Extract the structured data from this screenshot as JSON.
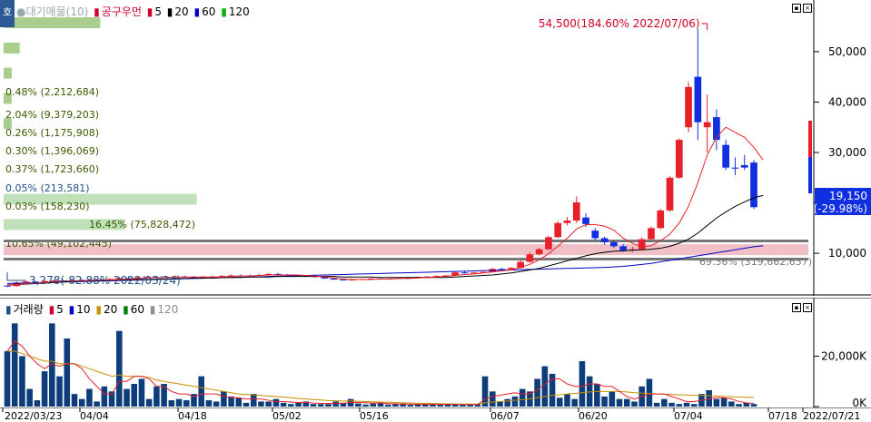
{
  "price_legend": {
    "title": "●대기매물(10)",
    "items": [
      {
        "label": "공구우먼",
        "color": "#d0002a"
      },
      {
        "label": "5",
        "color": "#d0002a"
      },
      {
        "label": "20",
        "color": "#000000"
      },
      {
        "label": "60",
        "color": "#0000c8"
      },
      {
        "label": "120",
        "color": "#00b000"
      }
    ]
  },
  "volume_legend": {
    "title": "거래량",
    "items": [
      {
        "label": "5",
        "color": "#d0002a"
      },
      {
        "label": "10",
        "color": "#0000c8"
      },
      {
        "label": "20",
        "color": "#c89000"
      },
      {
        "label": "60",
        "color": "#008000"
      },
      {
        "label": "120",
        "color": "#909090"
      }
    ]
  },
  "home_tab": "호",
  "annotations": {
    "high": "54,500(184.60% 2022/07/06)",
    "low": "3,278(-82.88% 2022/03/24)",
    "current_price": "19,150",
    "current_change": "(-29.98%)"
  },
  "volume_profile": [
    {
      "label": "0.48% (2,212,684)",
      "price": 55000,
      "width": 0.12,
      "color": "#a0c880"
    },
    {
      "label": "2.04% (9,379,203)",
      "price": 50000,
      "width": 0.02,
      "color": "#a0c880"
    },
    {
      "label": "0.26% (1,175,908)",
      "price": 45000,
      "width": 0.01,
      "color": "#a0c880"
    },
    {
      "label": "0.30% (1,396,069)",
      "price": 40000,
      "width": 0.01,
      "color": "#a0c880"
    },
    {
      "label": "0.37% (1,723,660)",
      "price": 35000,
      "width": 0.01,
      "color": "#a0c880"
    },
    {
      "label": "0.05% (213,581)",
      "price": 30000,
      "width": 0.0,
      "color": "#a0c880"
    },
    {
      "label": "0.03% (158,230)",
      "price": 25000,
      "width": 0.0,
      "color": "#a0c880"
    },
    {
      "label": "16.45% (75,828,472)",
      "price": 20000,
      "width": 0.24,
      "color": "#b8ddb0"
    },
    {
      "label": "10.65% (49,102,445)",
      "price": 15000,
      "width": 0.15,
      "color": "#b8ddb0"
    },
    {
      "label": "69.36% (319,662,657)",
      "price": 10000,
      "width": 1.0,
      "color": "#f0b8c0"
    }
  ],
  "chart_data": [
    {
      "type": "candlestick",
      "name": "price",
      "y_ticks": [
        "50,000",
        "40,000",
        "30,000",
        "20,000",
        "10,000"
      ],
      "y_tick_values": [
        50000,
        40000,
        30000,
        20000,
        10000
      ],
      "ylim": [
        3000,
        57000
      ],
      "grid": false,
      "candles": [
        {
          "o": 3600,
          "c": 3500,
          "h": 3700,
          "l": 3278
        },
        {
          "o": 3500,
          "c": 4200,
          "h": 4400,
          "l": 3400
        },
        {
          "o": 4200,
          "c": 4400,
          "h": 4600,
          "l": 4000
        },
        {
          "o": 4400,
          "c": 4300,
          "h": 4500,
          "l": 4100
        },
        {
          "o": 4300,
          "c": 4500,
          "h": 4700,
          "l": 4200
        },
        {
          "o": 4500,
          "c": 4600,
          "h": 4800,
          "l": 4300
        },
        {
          "o": 4600,
          "c": 4500,
          "h": 4800,
          "l": 4400
        },
        {
          "o": 4500,
          "c": 4700,
          "h": 4900,
          "l": 4400
        },
        {
          "o": 4700,
          "c": 4600,
          "h": 4900,
          "l": 4500
        },
        {
          "o": 4600,
          "c": 4800,
          "h": 5000,
          "l": 4500
        },
        {
          "o": 4800,
          "c": 4700,
          "h": 5000,
          "l": 4600
        },
        {
          "o": 4700,
          "c": 4900,
          "h": 5100,
          "l": 4600
        },
        {
          "o": 4900,
          "c": 5100,
          "h": 5300,
          "l": 4800
        },
        {
          "o": 5100,
          "c": 5000,
          "h": 5300,
          "l": 4900
        },
        {
          "o": 5000,
          "c": 5200,
          "h": 5400,
          "l": 4900
        },
        {
          "o": 5200,
          "c": 5300,
          "h": 5500,
          "l": 5100
        },
        {
          "o": 5300,
          "c": 5200,
          "h": 5500,
          "l": 5100
        },
        {
          "o": 5200,
          "c": 5300,
          "h": 5500,
          "l": 5100
        },
        {
          "o": 5300,
          "c": 5400,
          "h": 5600,
          "l": 5200
        },
        {
          "o": 5400,
          "c": 5300,
          "h": 5600,
          "l": 5200
        },
        {
          "o": 5300,
          "c": 5200,
          "h": 5500,
          "l": 5100
        },
        {
          "o": 5200,
          "c": 5300,
          "h": 5500,
          "l": 5100
        },
        {
          "o": 5300,
          "c": 5400,
          "h": 5600,
          "l": 5200
        },
        {
          "o": 5400,
          "c": 5500,
          "h": 5700,
          "l": 5300
        },
        {
          "o": 5500,
          "c": 5600,
          "h": 5800,
          "l": 5400
        },
        {
          "o": 5600,
          "c": 5500,
          "h": 5800,
          "l": 5400
        },
        {
          "o": 5500,
          "c": 5600,
          "h": 5800,
          "l": 5400
        },
        {
          "o": 5600,
          "c": 5700,
          "h": 5900,
          "l": 5500
        },
        {
          "o": 5700,
          "c": 5900,
          "h": 6100,
          "l": 5600
        },
        {
          "o": 5900,
          "c": 5800,
          "h": 6100,
          "l": 5700
        },
        {
          "o": 5800,
          "c": 5700,
          "h": 5900,
          "l": 5600
        },
        {
          "o": 5700,
          "c": 5600,
          "h": 5800,
          "l": 5500
        },
        {
          "o": 5600,
          "c": 5500,
          "h": 5700,
          "l": 5400
        },
        {
          "o": 5500,
          "c": 5300,
          "h": 5600,
          "l": 5200
        },
        {
          "o": 5300,
          "c": 5000,
          "h": 5400,
          "l": 4900
        },
        {
          "o": 5000,
          "c": 4800,
          "h": 5100,
          "l": 4700
        },
        {
          "o": 4800,
          "c": 4700,
          "h": 4900,
          "l": 4600
        },
        {
          "o": 4700,
          "c": 4800,
          "h": 4900,
          "l": 4600
        },
        {
          "o": 4800,
          "c": 4900,
          "h": 5000,
          "l": 4700
        },
        {
          "o": 4900,
          "c": 5000,
          "h": 5100,
          "l": 4800
        },
        {
          "o": 5000,
          "c": 4900,
          "h": 5100,
          "l": 4800
        },
        {
          "o": 4900,
          "c": 5000,
          "h": 5100,
          "l": 4800
        },
        {
          "o": 5000,
          "c": 5100,
          "h": 5200,
          "l": 4900
        },
        {
          "o": 5100,
          "c": 5200,
          "h": 5300,
          "l": 5000
        },
        {
          "o": 5200,
          "c": 5300,
          "h": 5400,
          "l": 5100
        },
        {
          "o": 5300,
          "c": 5400,
          "h": 5500,
          "l": 5200
        },
        {
          "o": 5400,
          "c": 5500,
          "h": 5600,
          "l": 5300
        },
        {
          "o": 5500,
          "c": 5600,
          "h": 5700,
          "l": 5400
        },
        {
          "o": 5600,
          "c": 6200,
          "h": 6400,
          "l": 5500
        },
        {
          "o": 6200,
          "c": 6100,
          "h": 6400,
          "l": 6000
        },
        {
          "o": 6100,
          "c": 6200,
          "h": 6300,
          "l": 6000
        },
        {
          "o": 6200,
          "c": 6300,
          "h": 6400,
          "l": 6100
        },
        {
          "o": 6300,
          "c": 6900,
          "h": 7100,
          "l": 6200
        },
        {
          "o": 6900,
          "c": 6800,
          "h": 7100,
          "l": 6700
        },
        {
          "o": 6800,
          "c": 7100,
          "h": 7300,
          "l": 6700
        },
        {
          "o": 7100,
          "c": 8300,
          "h": 8600,
          "l": 7000
        },
        {
          "o": 8300,
          "c": 9800,
          "h": 10200,
          "l": 8100
        },
        {
          "o": 9800,
          "c": 10800,
          "h": 11100,
          "l": 9600
        },
        {
          "o": 10800,
          "c": 13200,
          "h": 13500,
          "l": 10600
        },
        {
          "o": 13200,
          "c": 16000,
          "h": 16400,
          "l": 13000
        },
        {
          "o": 16000,
          "c": 16500,
          "h": 17200,
          "l": 15500
        },
        {
          "o": 16500,
          "c": 20100,
          "h": 21300,
          "l": 16000
        },
        {
          "o": 17100,
          "c": 15800,
          "h": 18000,
          "l": 15200
        },
        {
          "o": 14500,
          "c": 13000,
          "h": 15000,
          "l": 12500
        },
        {
          "o": 13000,
          "c": 12200,
          "h": 13300,
          "l": 11700
        },
        {
          "o": 12200,
          "c": 11400,
          "h": 12500,
          "l": 11000
        },
        {
          "o": 11400,
          "c": 10600,
          "h": 11800,
          "l": 10300
        },
        {
          "o": 10600,
          "c": 10800,
          "h": 11300,
          "l": 10300
        },
        {
          "o": 10800,
          "c": 12800,
          "h": 13200,
          "l": 10600
        },
        {
          "o": 12800,
          "c": 15000,
          "h": 15300,
          "l": 12500
        },
        {
          "o": 15000,
          "c": 18500,
          "h": 18800,
          "l": 14800
        },
        {
          "o": 18500,
          "c": 25000,
          "h": 25300,
          "l": 18300
        },
        {
          "o": 25000,
          "c": 32500,
          "h": 32800,
          "l": 24800
        },
        {
          "o": 35000,
          "c": 43000,
          "h": 44000,
          "l": 34000
        },
        {
          "o": 45000,
          "c": 36000,
          "h": 54500,
          "l": 32500
        },
        {
          "o": 35000,
          "c": 36000,
          "h": 41500,
          "l": 30000
        },
        {
          "o": 37000,
          "c": 32500,
          "h": 38500,
          "l": 30500
        },
        {
          "o": 31500,
          "c": 27000,
          "h": 32500,
          "l": 26500
        },
        {
          "o": 27000,
          "c": 26800,
          "h": 29000,
          "l": 25500
        },
        {
          "o": 27500,
          "c": 27000,
          "h": 29500,
          "l": 26500
        },
        {
          "o": 28000,
          "c": 19150,
          "h": 28500,
          "l": 18800
        }
      ],
      "ma5": [
        3600,
        3800,
        4000,
        4100,
        4200,
        4400,
        4500,
        4500,
        4600,
        4600,
        4700,
        4700,
        4800,
        4900,
        5000,
        5100,
        5200,
        5200,
        5300,
        5300,
        5300,
        5300,
        5300,
        5300,
        5400,
        5500,
        5500,
        5600,
        5700,
        5700,
        5700,
        5700,
        5600,
        5500,
        5300,
        5100,
        4900,
        4800,
        4800,
        4800,
        4900,
        4900,
        5000,
        5000,
        5100,
        5200,
        5300,
        5400,
        5600,
        5800,
        5900,
        6100,
        6300,
        6500,
        6700,
        7200,
        7800,
        8700,
        9900,
        11400,
        13000,
        14800,
        15700,
        15700,
        15400,
        14600,
        13000,
        12000,
        11300,
        11500,
        12500,
        13800,
        16000,
        19300,
        24000,
        29500,
        33000,
        35000,
        34000,
        33000,
        31000,
        28500
      ],
      "ma20": [
        3700,
        3800,
        3900,
        4000,
        4100,
        4200,
        4300,
        4400,
        4500,
        4500,
        4600,
        4600,
        4700,
        4700,
        4800,
        4800,
        4900,
        4900,
        5000,
        5000,
        5100,
        5100,
        5100,
        5200,
        5200,
        5200,
        5300,
        5300,
        5300,
        5400,
        5400,
        5400,
        5400,
        5400,
        5400,
        5400,
        5300,
        5300,
        5300,
        5300,
        5200,
        5200,
        5200,
        5200,
        5200,
        5200,
        5200,
        5200,
        5300,
        5400,
        5500,
        5600,
        5700,
        5900,
        6100,
        6400,
        6700,
        7000,
        7500,
        8000,
        8500,
        9000,
        9500,
        9900,
        10200,
        10400,
        10500,
        10600,
        10700,
        10800,
        11000,
        11400,
        12000,
        12800,
        14000,
        15500,
        17000,
        18200,
        19300,
        20200,
        21000,
        21500
      ],
      "ma60": [
        4000,
        4050,
        4100,
        4150,
        4200,
        4250,
        4300,
        4350,
        4400,
        4450,
        4500,
        4550,
        4600,
        4650,
        4700,
        4750,
        4800,
        4850,
        4900,
        4950,
        5000,
        5050,
        5100,
        5150,
        5200,
        5250,
        5300,
        5350,
        5400,
        5450,
        5500,
        5550,
        5600,
        5650,
        5700,
        5750,
        5800,
        5850,
        5900,
        5950,
        6000,
        6050,
        6100,
        6150,
        6200,
        6250,
        6300,
        6350,
        6400,
        6450,
        6500,
        6550,
        6600,
        6650,
        6700,
        6750,
        6800,
        6850,
        6900,
        6950,
        7000,
        7050,
        7100,
        7150,
        7200,
        7300,
        7400,
        7600,
        7800,
        8000,
        8300,
        8600,
        8900,
        9200,
        9500,
        9800,
        10100,
        10400,
        10700,
        11000,
        11300,
        11500
      ]
    },
    {
      "type": "bar",
      "name": "volume",
      "y_ticks": [
        "20,000K",
        "0K"
      ],
      "y_tick_values": [
        20000,
        0
      ],
      "ylim": [
        0,
        36000
      ],
      "x_ticks": [
        "2022/03/23",
        "04/04",
        "04/18",
        "05/02",
        "05/16",
        "06/07",
        "06/20",
        "07/04",
        "07/18",
        "2022/07/21"
      ],
      "x_tick_index": [
        0,
        13,
        26,
        38,
        50,
        69,
        82,
        95,
        109,
        113
      ],
      "values": [
        22000,
        33000,
        20000,
        7000,
        2500,
        14000,
        33000,
        12000,
        27000,
        5000,
        3000,
        7000,
        2000,
        8000,
        6000,
        30000,
        7000,
        9000,
        11000,
        3000,
        8000,
        9000,
        2500,
        3000,
        2500,
        5000,
        12000,
        2500,
        2000,
        6000,
        4000,
        3500,
        1500,
        5000,
        2000,
        2000,
        3000,
        1500,
        1000,
        1500,
        2000,
        1000,
        1000,
        1000,
        2000,
        1500,
        3000,
        1200,
        800,
        1200,
        1500,
        800,
        1000,
        1200,
        700,
        900,
        1000,
        900,
        700,
        800,
        900,
        700,
        800,
        900,
        12000,
        6000,
        2000,
        3000,
        4000,
        7000,
        6000,
        11000,
        16000,
        13000,
        3500,
        5000,
        3000,
        18000,
        12000,
        9000,
        4000,
        6000,
        3000,
        3000,
        2000,
        8000,
        11000,
        1500,
        3000,
        1500,
        1000,
        1500,
        1000,
        5000,
        6500,
        3000,
        3500,
        2000,
        1000,
        1500,
        1000
      ],
      "colors_up": [
        0,
        5,
        8,
        15,
        18,
        26,
        29,
        64,
        69,
        71,
        72,
        73,
        74,
        75,
        76,
        77,
        78,
        79,
        80,
        81,
        85,
        86,
        87
      ],
      "vma5": [
        22000,
        26000,
        24000,
        20000,
        17000,
        15000,
        17000,
        16000,
        17000,
        17000,
        15000,
        11000,
        8000,
        5000,
        5000,
        10000,
        10000,
        12000,
        12000,
        11000,
        8000,
        8000,
        6000,
        5000,
        5000,
        4000,
        5000,
        5000,
        5000,
        4000,
        3500,
        3500,
        3000,
        3000,
        3000,
        2500,
        2000,
        2000,
        1800,
        1600,
        1600,
        1400,
        1300,
        1200,
        1300,
        1300,
        1600,
        1600,
        1500,
        1400,
        1400,
        1200,
        1100,
        1000,
        1000,
        900,
        900,
        900,
        850,
        850,
        850,
        800,
        800,
        800,
        3000,
        4000,
        4500,
        5000,
        5500,
        5000,
        5000,
        6500,
        9000,
        11000,
        11000,
        9000,
        8000,
        8000,
        9000,
        9000,
        8000,
        8000,
        6000,
        4000,
        3000,
        4000,
        5000,
        5000,
        5000,
        4000,
        3000,
        2000,
        2000,
        2500,
        3000,
        3500,
        3500,
        3000,
        2000,
        1500,
        1200
      ],
      "vma20": [
        22000,
        22000,
        21000,
        20000,
        19000,
        18000,
        18000,
        17000,
        17000,
        17000,
        16000,
        15000,
        14000,
        13000,
        12000,
        12500,
        12000,
        12000,
        12000,
        11500,
        10500,
        10000,
        9500,
        9000,
        8500,
        8000,
        7500,
        7000,
        6500,
        6000,
        5500,
        5000,
        4800,
        4600,
        4400,
        4200,
        4000,
        3800,
        3500,
        3200,
        3000,
        2800,
        2600,
        2400,
        2300,
        2200,
        2200,
        2100,
        2000,
        1900,
        1800,
        1700,
        1600,
        1500,
        1400,
        1300,
        1250,
        1200,
        1150,
        1100,
        1050,
        1000,
        1000,
        1000,
        1500,
        1800,
        2000,
        2200,
        2500,
        2800,
        3100,
        3500,
        4000,
        4500,
        4700,
        5000,
        5200,
        5500,
        5800,
        6000,
        6000,
        6000,
        6000,
        5800,
        5500,
        5300,
        5200,
        5000,
        4900,
        4800,
        4700,
        4600,
        4500,
        4400,
        4300,
        4200,
        4000,
        3900,
        3800,
        3700,
        3600
      ]
    }
  ]
}
